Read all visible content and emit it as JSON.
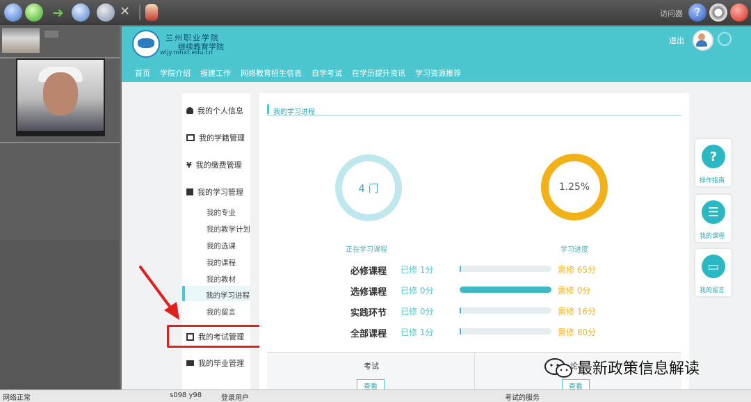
{
  "toolbar": {
    "buttons": [
      "home",
      "back",
      "forward",
      "refresh",
      "accessibility",
      "tools",
      "user"
    ],
    "status_text": "访问器",
    "right_icons": [
      "help-icon",
      "settings-icon",
      "power-icon"
    ]
  },
  "site": {
    "logo_title": "兰州职业学院",
    "logo_sub": "继续教育学院",
    "logo_url": "wljy.mhxt.edu.cn",
    "user_name": "退出"
  },
  "nav": [
    "首页",
    "学院介绍",
    "报建工作",
    "网络教育招生信息",
    "自学考试",
    "在学历提升资讯",
    "学习资源推荐"
  ],
  "sidebar": {
    "items": [
      {
        "label": "我的个人信息",
        "icon": "person-icon"
      },
      {
        "label": "我的学籍管理",
        "icon": "exchange-icon"
      },
      {
        "label": "我的缴费管理",
        "icon": "yen-icon"
      },
      {
        "label": "我的学习管理",
        "icon": "book-icon"
      }
    ],
    "sub_items": [
      "我的专业",
      "我的教学计划",
      "我的选课",
      "我的课程",
      "我的教材",
      "我的学习进程",
      "我的留言"
    ],
    "active_sub": "我的学习进程",
    "exam": {
      "label": "我的考试管理",
      "icon": "edit-icon"
    },
    "graduation": {
      "label": "我的毕业管理",
      "icon": "cap-icon"
    }
  },
  "main": {
    "title": "我的学习进程",
    "ring1": {
      "value": "4 门",
      "label": "正在学习课程"
    },
    "ring2": {
      "value": "1.25%",
      "label": "学习进度",
      "progress": 0.0125
    },
    "courses": [
      {
        "name": "必修课程",
        "earned": "已修 1分",
        "progress": 0.015,
        "need": "需修 65分"
      },
      {
        "name": "选修课程",
        "earned": "已修 0分",
        "progress": 1.0,
        "need": "需修 0分"
      },
      {
        "name": "实践环节",
        "earned": "已修 0分",
        "progress": 0.0,
        "need": "需修 16分"
      },
      {
        "name": "全部课程",
        "earned": "已修 1分",
        "progress": 0.012,
        "need": "需修 80分"
      }
    ],
    "table": {
      "col1": "考试",
      "col2": "论文",
      "btn": "查看"
    }
  },
  "floats": [
    {
      "glyph": "?",
      "label": "操作指南"
    },
    {
      "glyph": "☰",
      "label": "我的课程"
    },
    {
      "glyph": "▭",
      "label": "我的留言"
    }
  ],
  "status": {
    "left": "网络正常",
    "mid1": "s098 y98",
    "mid2": "登录用户",
    "right": "考试的服务"
  },
  "watermark": "最新政策信息解读",
  "colors": {
    "accent": "#4cc6cf",
    "orange": "#f2b116",
    "highlight_red": "#e0201c"
  }
}
